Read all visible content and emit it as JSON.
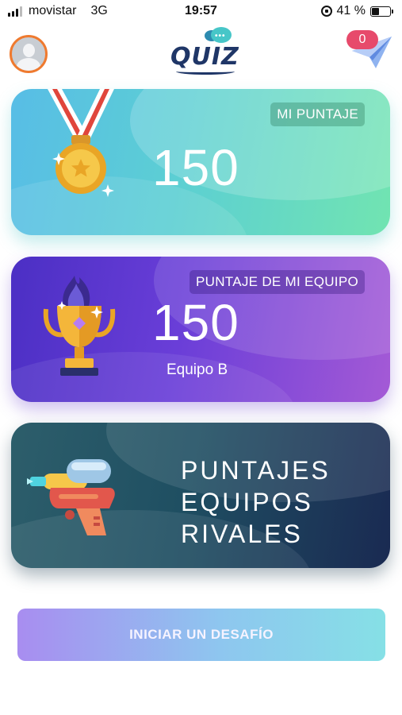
{
  "status_bar": {
    "carrier": "movistar",
    "network": "3G",
    "time": "19:57",
    "battery_percent": "41 %",
    "battery_level": 0.41
  },
  "header": {
    "logo_text": "QUIZ",
    "notification_count": "0"
  },
  "score_card": {
    "label": "MI PUNTAJE",
    "value": "150",
    "icon": "medal-icon"
  },
  "team_card": {
    "label": "PUNTAJE DE MI EQUIPO",
    "value": "150",
    "team_name": "Equipo B",
    "icon": "trophy-icon"
  },
  "rivals_card": {
    "line1": "PUNTAJES",
    "line2": "EQUIPOS",
    "line3": "RIVALES",
    "icon": "water-gun-icon"
  },
  "cta": {
    "label": "INICIAR UN DESAFÍO"
  },
  "colors": {
    "score_gradient": [
      "#58bde6",
      "#71e4b1"
    ],
    "team_gradient": [
      "#4b2fc4",
      "#a45ad6"
    ],
    "rivals_gradient": [
      "#2d5e6b",
      "#1a2a52"
    ],
    "badge": "#e74a6b",
    "avatar_ring": "#ef7a2f"
  }
}
